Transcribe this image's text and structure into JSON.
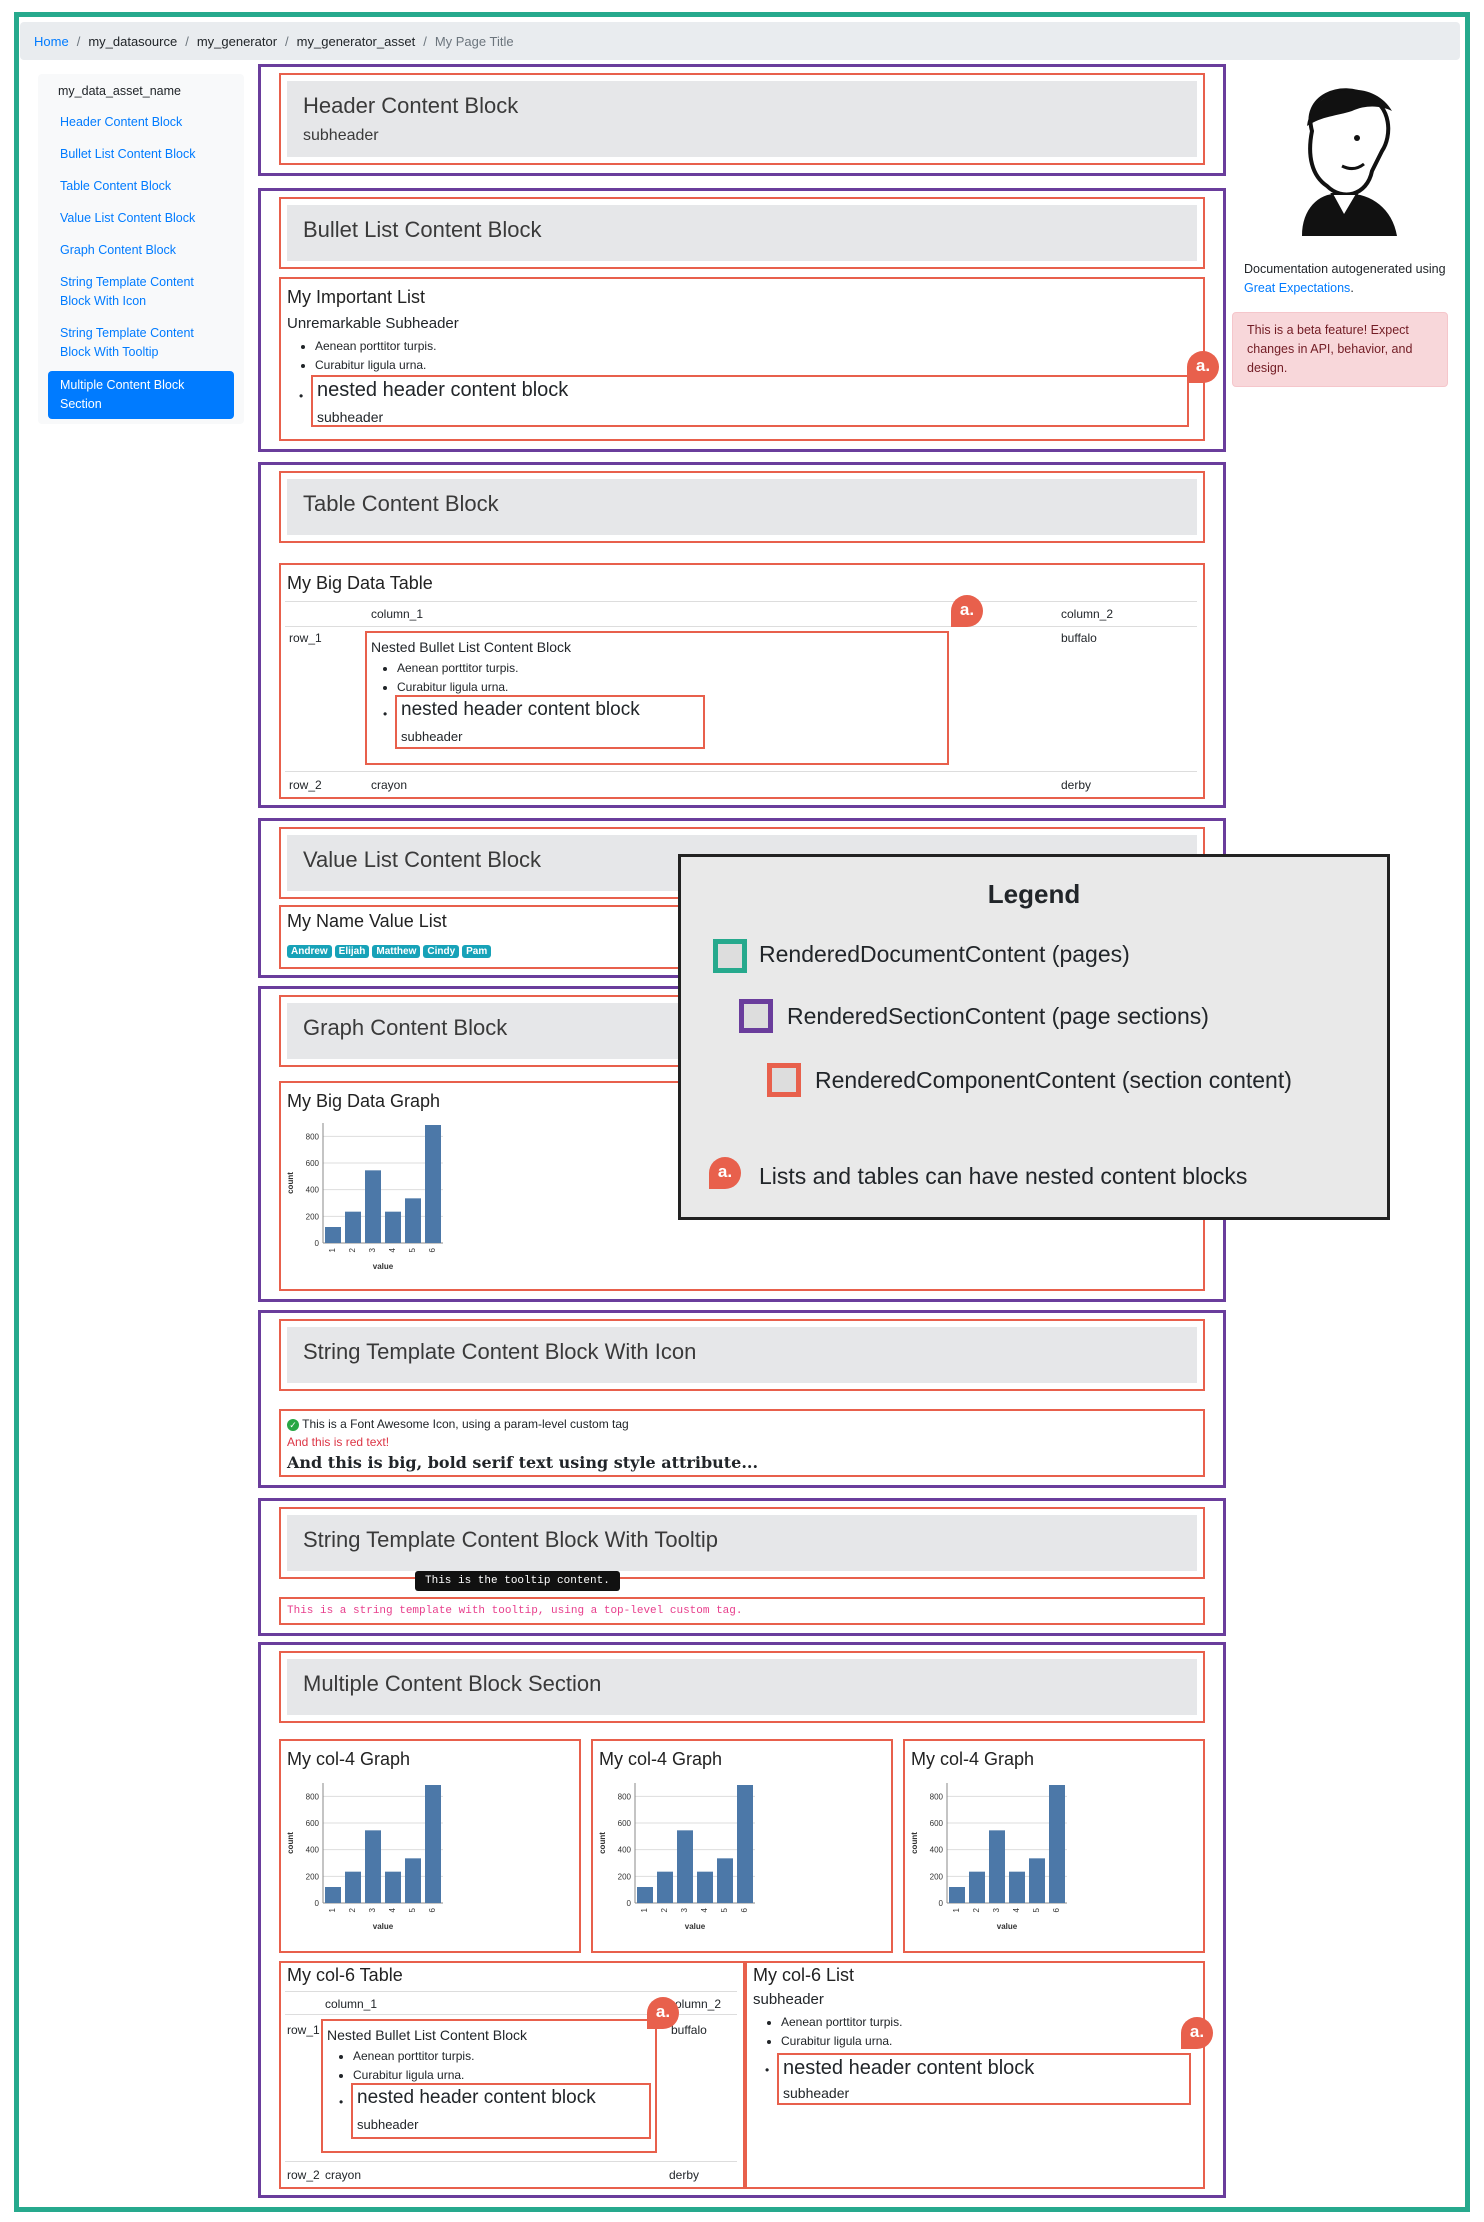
{
  "breadcrumb": {
    "home": "Home",
    "datasource": "my_datasource",
    "generator": "my_generator",
    "asset": "my_generator_asset",
    "current": "My Page Title"
  },
  "sidebar": {
    "title": "my_data_asset_name",
    "items": [
      {
        "label": "Header Content Block"
      },
      {
        "label": "Bullet List Content Block"
      },
      {
        "label": "Table Content Block"
      },
      {
        "label": "Value List Content Block"
      },
      {
        "label": "Graph Content Block"
      },
      {
        "label": "String Template Content Block With Icon"
      },
      {
        "label": "String Template Content Block With Tooltip"
      },
      {
        "label": "Multiple Content Block Section"
      }
    ]
  },
  "doc": {
    "text": "Documentation autogenerated using",
    "link": "Great Expectations",
    "period": "."
  },
  "alert": "This is a beta feature! Expect changes in API, behavior, and design.",
  "sections": {
    "header": {
      "title": "Header Content Block",
      "subheader": "subheader"
    },
    "bullet": {
      "title": "Bullet List Content Block",
      "list_title": "My Important List",
      "list_sub": "Unremarkable Subheader",
      "items": [
        "Aenean porttitor turpis.",
        "Curabitur ligula urna."
      ],
      "nested_title": "nested header content block",
      "nested_sub": "subheader"
    },
    "table": {
      "title": "Table Content Block",
      "table_title": "My Big Data Table",
      "col1": "column_1",
      "col2": "column_2",
      "r1": "row_1",
      "r1c2": "buffalo",
      "nested_title": "Nested Bullet List Content Block",
      "items": [
        "Aenean porttitor turpis.",
        "Curabitur ligula urna."
      ],
      "nested_header": "nested header content block",
      "nested_sub": "subheader",
      "r2": "row_2",
      "r2c1": "crayon",
      "r2c2": "derby"
    },
    "valuelist": {
      "title": "Value List Content Block",
      "list_title": "My Name Value List",
      "values": [
        "Andrew",
        "Elijah",
        "Matthew",
        "Cindy",
        "Pam"
      ]
    },
    "graph": {
      "title": "Graph Content Block",
      "graph_title": "My Big Data Graph"
    },
    "icon": {
      "title": "String Template Content Block With Icon",
      "line1": "This is a Font Awesome Icon, using a param-level custom tag",
      "line2": "And this is red text!",
      "line3": "And this is big, bold serif text using style attribute..."
    },
    "tooltip": {
      "title": "String Template Content Block With Tooltip",
      "tooltip": "This is the tooltip content.",
      "text": "This is a string template with tooltip, using a top-level custom tag."
    },
    "multi": {
      "title": "Multiple Content Block Section",
      "graph_title": "My col-4 Graph",
      "table_title": "My col-6 Table",
      "list_title": "My col-6 List",
      "list_sub": "subheader"
    }
  },
  "legend": {
    "title": "Legend",
    "doc": "RenderedDocumentContent (pages)",
    "section": "RenderedSectionContent (page sections)",
    "component": "RenderedComponentContent (section content)",
    "note": "Lists and tables can have nested content blocks",
    "colors": {
      "doc": "#26a98d",
      "section": "#6a3d9c",
      "component": "#e8604c"
    }
  },
  "marker": "a.",
  "chart_data": {
    "type": "bar",
    "categories": [
      "1",
      "2",
      "3",
      "4",
      "5",
      "6"
    ],
    "values": [
      120,
      235,
      545,
      235,
      335,
      885
    ],
    "xlabel": "value",
    "ylabel": "count",
    "ylim": [
      0,
      900
    ],
    "yticks": [
      0,
      200,
      400,
      600,
      800
    ],
    "color": "#4c78a8"
  }
}
